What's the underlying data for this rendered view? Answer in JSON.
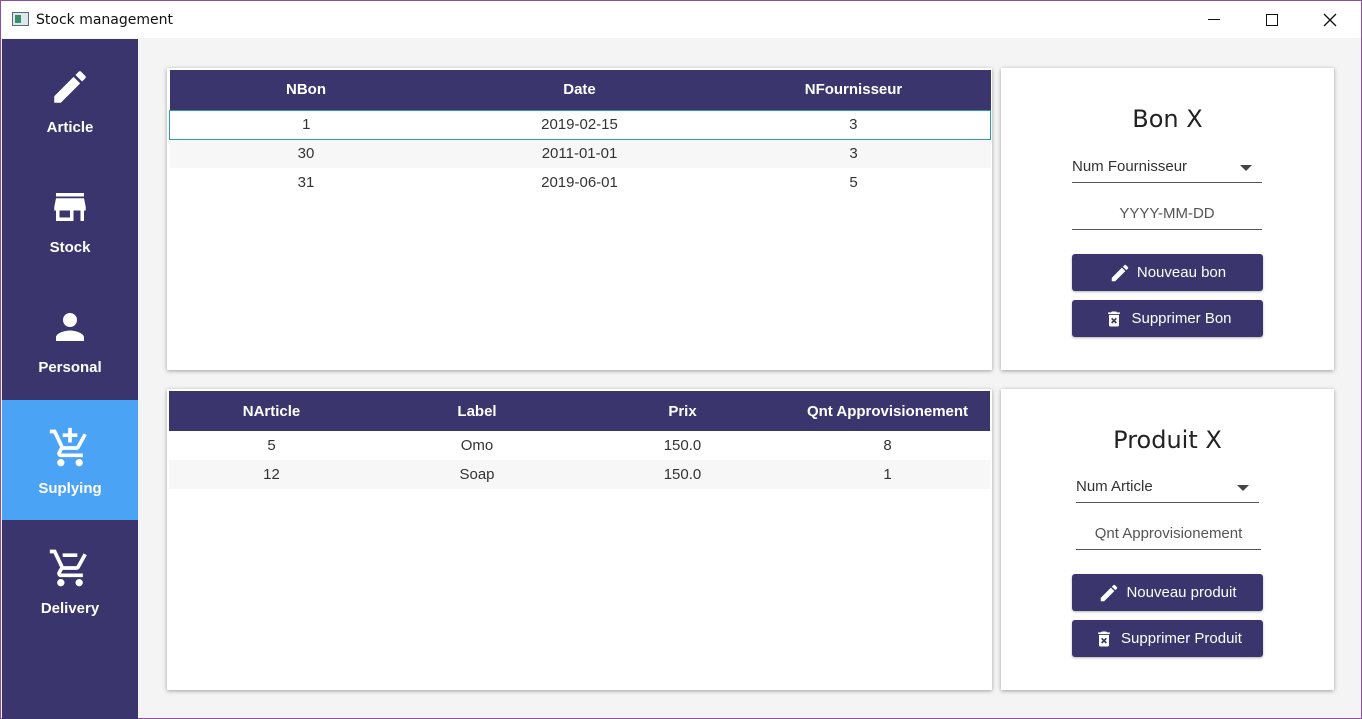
{
  "window": {
    "title": "Stock management"
  },
  "sidebar": {
    "items": [
      {
        "label": "Article",
        "icon": "pencil-icon"
      },
      {
        "label": "Stock",
        "icon": "store-icon"
      },
      {
        "label": "Personal",
        "icon": "person-icon"
      },
      {
        "label": "Suplying",
        "icon": "cart-plus-icon",
        "active": true
      },
      {
        "label": "Delivery",
        "icon": "cart-remove-icon"
      }
    ]
  },
  "bon_table": {
    "columns": [
      "NBon",
      "Date",
      "NFournisseur"
    ],
    "rows": [
      [
        "1",
        "2019-02-15",
        "3"
      ],
      [
        "30",
        "2011-01-01",
        "3"
      ],
      [
        "31",
        "2019-06-01",
        "5"
      ]
    ],
    "selected_row": 0
  },
  "article_table": {
    "columns": [
      "NArticle",
      "Label",
      "Prix",
      "Qnt Approvisionement"
    ],
    "rows": [
      [
        "5",
        "Omo",
        "150.0",
        "8"
      ],
      [
        "12",
        "Soap",
        "150.0",
        "1"
      ]
    ]
  },
  "bon_form": {
    "title": "Bon X",
    "fournisseur_dropdown": "Num Fournisseur",
    "date_placeholder": "YYYY-MM-DD",
    "new_button": "Nouveau bon",
    "delete_button": "Supprimer Bon"
  },
  "produit_form": {
    "title": "Produit X",
    "article_dropdown": "Num Article",
    "qnt_placeholder": "Qnt Approvisionement",
    "new_button": "Nouveau produit",
    "delete_button": "Supprimer Produit"
  },
  "colors": {
    "primary": "#3a356c",
    "active_nav": "#4aa3f5",
    "selection_border": "#2c9ea3"
  }
}
